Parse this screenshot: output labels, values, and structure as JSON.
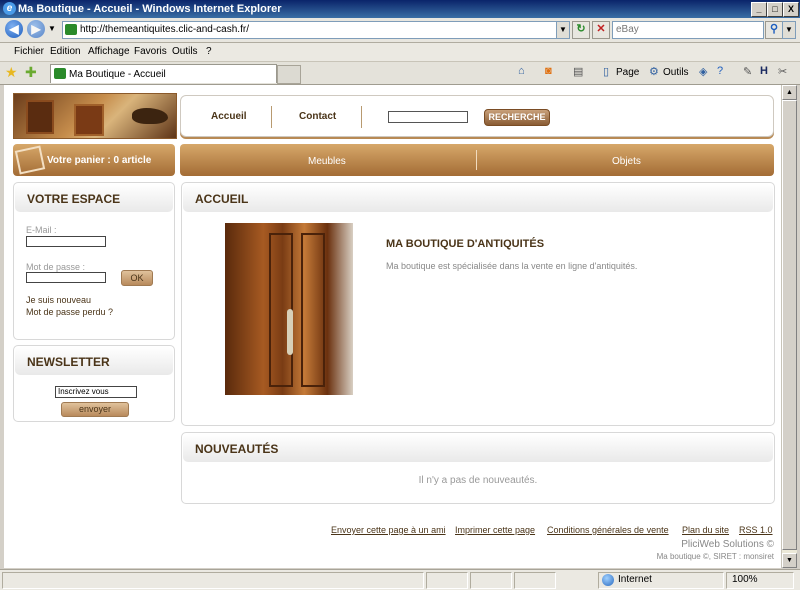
{
  "window": {
    "title": "Ma Boutique - Accueil - Windows Internet Explorer",
    "controls": {
      "minimize": "_",
      "maximize": "□",
      "close": "X"
    }
  },
  "address_bar": {
    "url": "http://themeantiquites.clic-and-cash.fr/",
    "search_placeholder": "eBay",
    "back_glyph": "◀",
    "forward_glyph": "▶",
    "refresh_glyph": "↻",
    "stop_glyph": "✕",
    "search_glyph": "⚲"
  },
  "menu": {
    "items": [
      "Fichier",
      "Edition",
      "Affichage",
      "Favoris",
      "Outils",
      "?"
    ]
  },
  "tabs": {
    "active_tab_label": "Ma Boutique - Accueil",
    "toolbar": {
      "page_label": "Page",
      "tools_label": "Outils"
    }
  },
  "site": {
    "nav": {
      "home": "Accueil",
      "contact": "Contact",
      "search_button": "RECHERCHE"
    },
    "cart": {
      "label": "Votre panier : 0 article"
    },
    "categories": [
      "Meubles",
      "Objets"
    ],
    "account": {
      "title": "VOTRE ESPACE",
      "email_label": "E-Mail :",
      "password_label": "Mot de passe :",
      "ok_button": "OK",
      "new_user_link": "Je suis nouveau",
      "lost_password_link": "Mot de passe perdu ?"
    },
    "newsletter": {
      "title": "NEWSLETTER",
      "input_value": "Inscrivez vous",
      "send_button": "envoyer"
    },
    "main": {
      "title": "ACCUEIL",
      "shop_title": "MA BOUTIQUE D'ANTIQUITÉS",
      "shop_text": "Ma boutique est spécialisée dans la vente en ligne d'antiquités."
    },
    "news": {
      "title": "NOUVEAUTÉS",
      "empty_text": "Il n'y a pas de nouveautés."
    },
    "footer": {
      "links": [
        "Envoyer cette page à un ami",
        "Imprimer cette page",
        "Conditions générales de vente",
        "Plan du site",
        "RSS 1.0"
      ],
      "copyright": "PliciWeb Solutions ©",
      "siret": "Ma boutique ©, SIRET : monsiret"
    }
  },
  "status_bar": {
    "zone": "Internet",
    "zoom": "100%"
  },
  "colors": {
    "brand_brown": "#a36c35",
    "heading_text": "#4a3418",
    "title_bar": "#0a246a"
  }
}
